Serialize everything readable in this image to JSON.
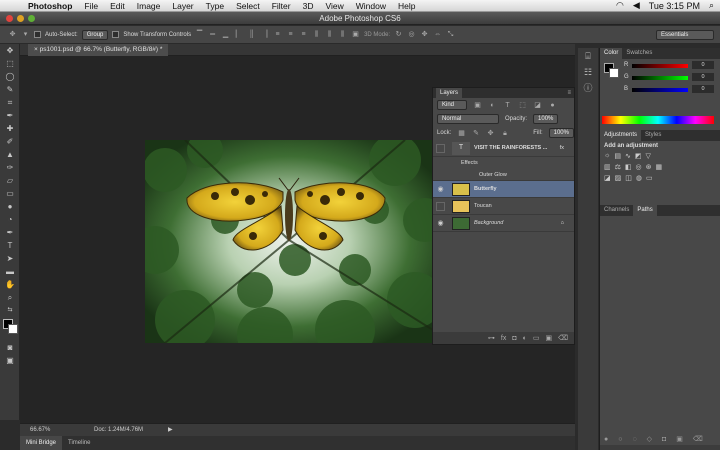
{
  "menubar": {
    "app": "Photoshop",
    "items": [
      "File",
      "Edit",
      "Image",
      "Layer",
      "Type",
      "Select",
      "Filter",
      "3D",
      "View",
      "Window",
      "Help"
    ],
    "clock": "Tue 3:15 PM"
  },
  "window": {
    "title": "Adobe Photoshop CS6"
  },
  "options": {
    "auto_select_label": "Auto-Select:",
    "auto_select_value": "Group",
    "show_transform": "Show Transform Controls",
    "mode_3d": "3D Mode:",
    "workspace": "Essentials"
  },
  "document": {
    "tab_label": "ps1001.psd @ 66.7% (Butterfly, RGB/8#) *",
    "zoom": "66.67%",
    "doc_size": "Doc: 1.24M/4.76M"
  },
  "layers_panel": {
    "title": "Layers",
    "kind_label": "Kind",
    "blend": "Normal",
    "opacity_label": "Opacity:",
    "opacity_value": "100%",
    "lock_label": "Lock:",
    "fill_label": "Fill:",
    "fill_value": "100%",
    "layers": [
      {
        "name": "VISIT THE RAINFORESTS ..."
      },
      {
        "name": "Effects"
      },
      {
        "name": "Outer Glow"
      },
      {
        "name": "Butterfly"
      },
      {
        "name": "Toucan"
      },
      {
        "name": "Background"
      }
    ]
  },
  "color_panel": {
    "tabs": [
      "Color",
      "Swatches"
    ],
    "r_label": "R",
    "r_value": "0",
    "g_label": "G",
    "g_value": "0",
    "b_label": "B",
    "b_value": "0"
  },
  "adjustments_panel": {
    "tabs": [
      "Adjustments",
      "Styles"
    ],
    "hint": "Add an adjustment"
  },
  "channels_panel": {
    "tabs": [
      "Channels",
      "Paths"
    ]
  },
  "bottom_tabs": [
    "Mini Bridge",
    "Timeline"
  ],
  "colors": {
    "accent": "#5a7fb5",
    "selected_row": "#5b6e8e"
  }
}
